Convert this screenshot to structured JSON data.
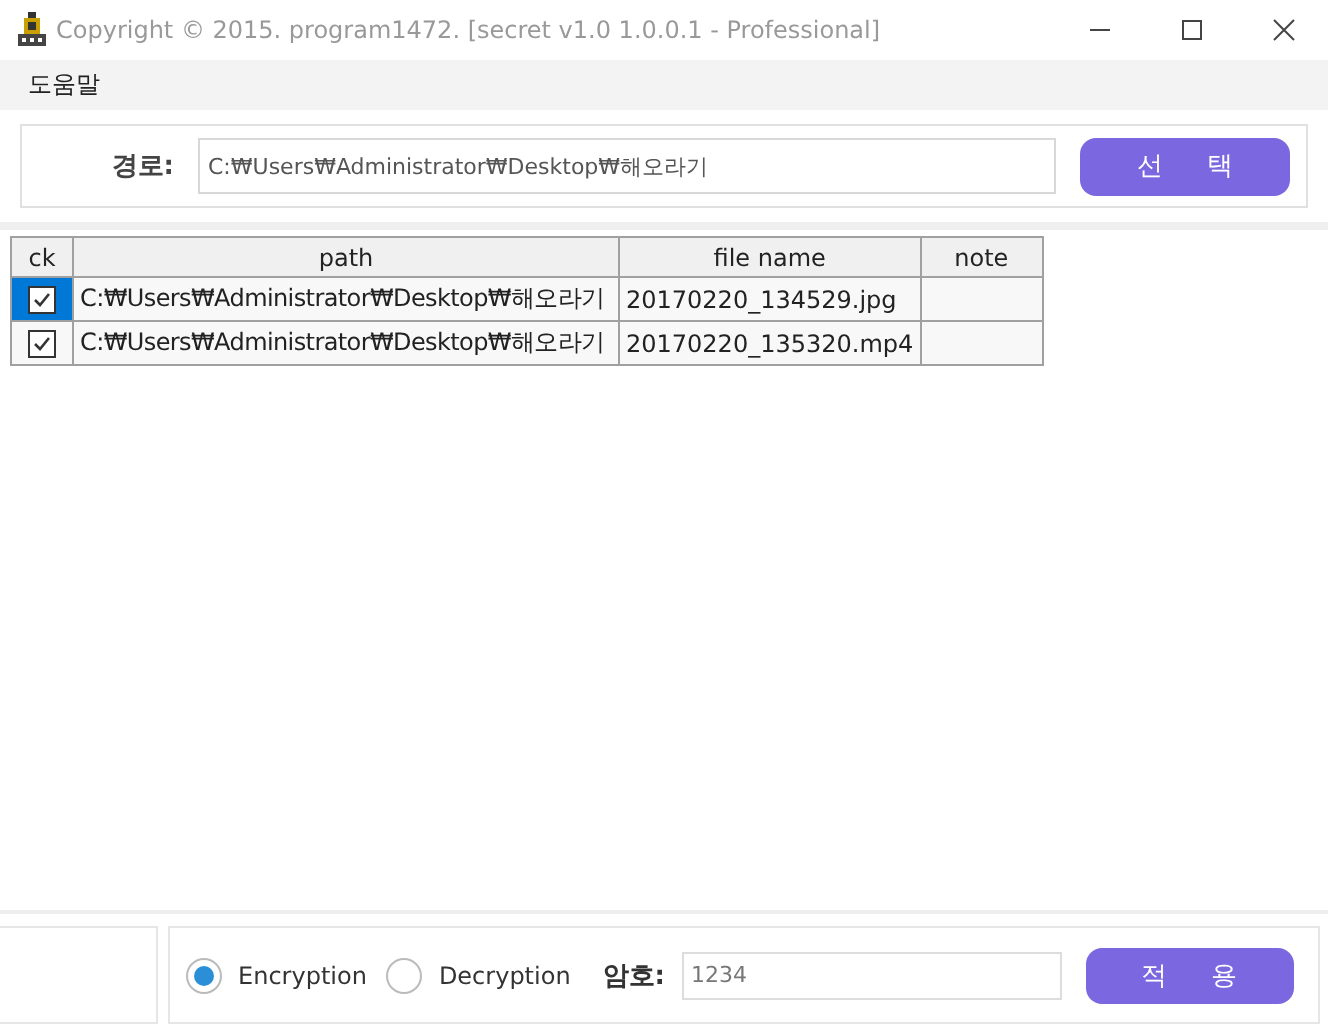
{
  "window": {
    "title": "Copyright © 2015. program1472. [secret v1.0 1.0.0.1 - Professional]"
  },
  "menu": [
    "도움말"
  ],
  "path_bar": {
    "label": "경로:",
    "value": "C:₩Users₩Administrator₩Desktop₩해오라기",
    "button": "선 택"
  },
  "table": {
    "columns": [
      "ck",
      "path",
      "file name",
      "note"
    ],
    "rows": [
      {
        "checked": true,
        "selected": true,
        "path": "C:₩Users₩Administrator₩Desktop₩해오라기",
        "file_name": "20170220_134529.jpg"
      },
      {
        "checked": true,
        "selected": false,
        "path": "C:₩Users₩Administrator₩Desktop₩해오라기",
        "file_name": "20170220_135320.mp4"
      }
    ]
  },
  "bottom": {
    "modes": [
      {
        "label": "Encryption",
        "selected": true
      },
      {
        "label": "Decryption",
        "selected": false
      }
    ],
    "password_label": "암호:",
    "password": "1234",
    "button": "적 용"
  }
}
